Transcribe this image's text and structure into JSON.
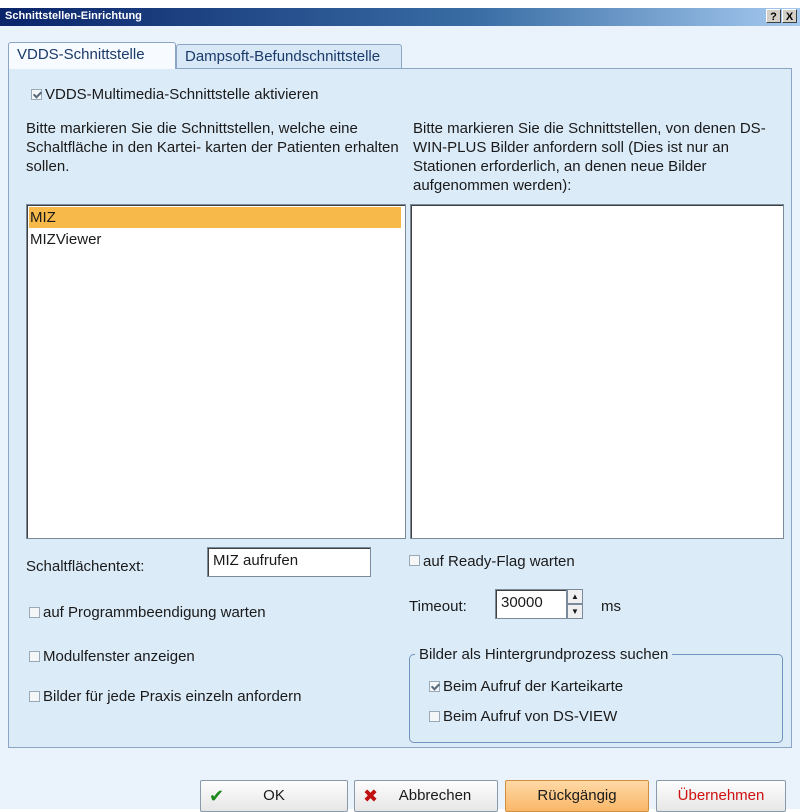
{
  "window": {
    "title": "Schnittstellen-Einrichtung",
    "help_label": "?",
    "close_label": "X"
  },
  "tabs": [
    {
      "label": "VDDS-Schnittstelle",
      "active": true
    },
    {
      "label": "Dampsoft-Befundschnittstelle",
      "active": false
    }
  ],
  "vdds": {
    "activate_label": "VDDS-Multimedia-Schnittstelle aktivieren",
    "activate_checked": true,
    "left_instruction": "Bitte markieren Sie die Schnittstellen, welche eine Schaltfläche in den Kartei- karten der Patienten erhalten sollen.",
    "right_instruction": "Bitte markieren Sie die Schnittstellen, von denen DS-WIN-PLUS Bilder anfordern soll (Dies ist nur an Stationen erforderlich, an denen neue Bilder aufgenommen werden):",
    "left_list": [
      "MIZ",
      "MIZViewer"
    ],
    "left_selected": "MIZ",
    "right_list": [],
    "button_text_label": "Schaltflächentext:",
    "button_text_value": "MIZ aufrufen",
    "wait_program_end_label": "auf Programmbeendigung warten",
    "show_module_window_label": "Modulfenster anzeigen",
    "images_per_practice_label": "Bilder für jede Praxis einzeln anfordern",
    "wait_ready_flag_label": "auf Ready-Flag warten",
    "timeout_label": "Timeout:",
    "timeout_value": "30000",
    "timeout_unit": "ms",
    "background_group_label": "Bilder als Hintergrundprozess suchen",
    "on_card_open_label": "Beim Aufruf der Karteikarte",
    "on_card_open_checked": true,
    "on_dsview_open_label": "Beim Aufruf von DS-VIEW",
    "on_dsview_open_checked": false
  },
  "buttons": {
    "ok": "OK",
    "cancel": "Abbrechen",
    "undo": "Rückgängig",
    "apply": "Übernehmen"
  },
  "colors": {
    "selection": "#f7b94a",
    "apply_text": "#d01010",
    "ok_icon": "#1e8a1e",
    "cancel_icon": "#c01010"
  }
}
